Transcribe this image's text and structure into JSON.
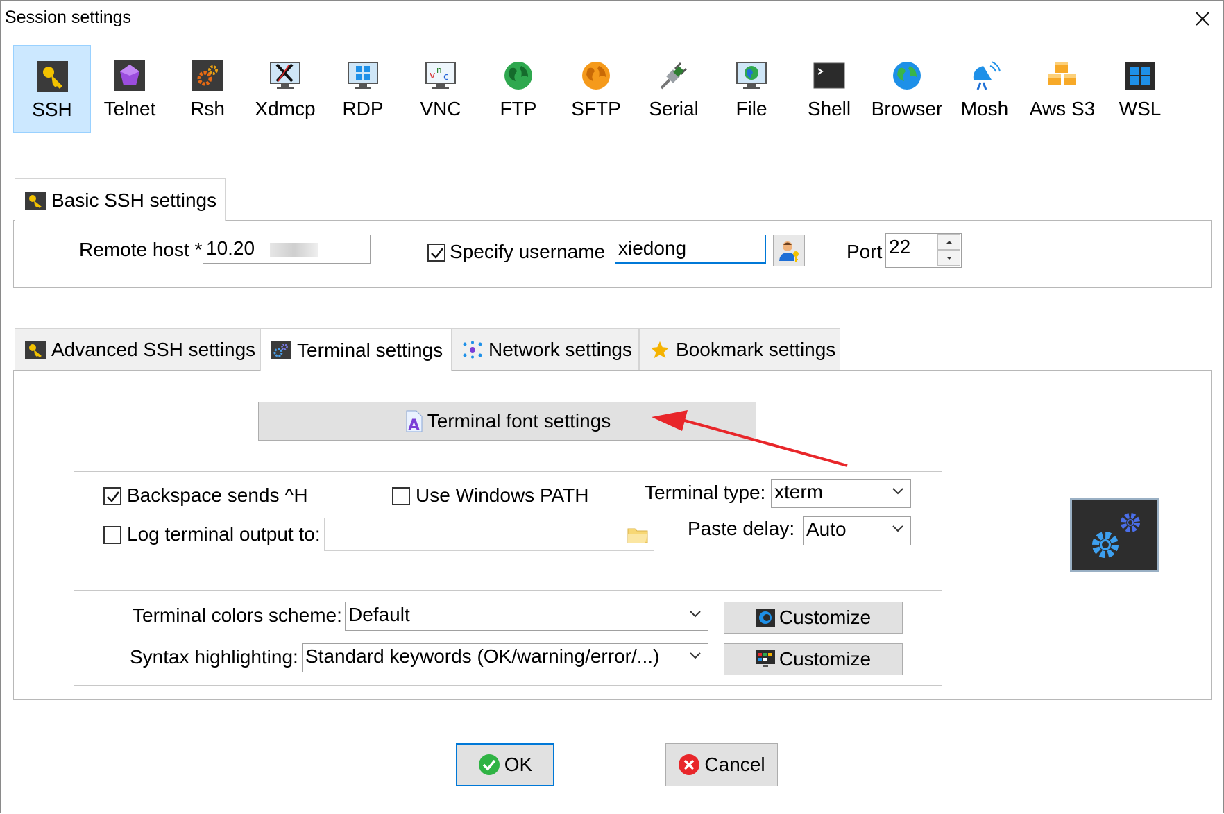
{
  "window": {
    "title": "Session settings"
  },
  "protocols": [
    {
      "label": "SSH",
      "icon": "key-icon",
      "selected": true
    },
    {
      "label": "Telnet",
      "icon": "gem-icon"
    },
    {
      "label": "Rsh",
      "icon": "gears-icon"
    },
    {
      "label": "Xdmcp",
      "icon": "x-monitor-icon"
    },
    {
      "label": "RDP",
      "icon": "windows-monitor-icon"
    },
    {
      "label": "VNC",
      "icon": "vnc-monitor-icon"
    },
    {
      "label": "FTP",
      "icon": "green-globe-icon"
    },
    {
      "label": "SFTP",
      "icon": "orange-globe-icon"
    },
    {
      "label": "Serial",
      "icon": "plug-icon"
    },
    {
      "label": "File",
      "icon": "file-monitor-icon"
    },
    {
      "label": "Shell",
      "icon": "terminal-icon"
    },
    {
      "label": "Browser",
      "icon": "globe-icon"
    },
    {
      "label": "Mosh",
      "icon": "satellite-dish-icon"
    },
    {
      "label": "Aws S3",
      "icon": "cubes-icon"
    },
    {
      "label": "WSL",
      "icon": "windows-logo-icon"
    }
  ],
  "basic": {
    "tab_label": "Basic SSH settings",
    "remote_host_label": "Remote host *",
    "remote_host_value": "10.20",
    "specify_username_label": "Specify username",
    "specify_username_checked": true,
    "username_value": "xiedong",
    "port_label": "Port",
    "port_value": "22"
  },
  "tabs": [
    {
      "label": "Advanced SSH settings",
      "icon": "key-icon"
    },
    {
      "label": "Terminal settings",
      "icon": "gears-icon",
      "active": true
    },
    {
      "label": "Network settings",
      "icon": "network-icon"
    },
    {
      "label": "Bookmark settings",
      "icon": "star-icon"
    }
  ],
  "terminal": {
    "font_button_label": "Terminal font settings",
    "backspace_label": "Backspace sends ^H",
    "backspace_checked": true,
    "use_windows_path_label": "Use Windows PATH",
    "use_windows_path_checked": false,
    "terminal_type_label": "Terminal type:",
    "terminal_type_value": "xterm",
    "log_output_label": "Log terminal output to:",
    "log_output_checked": false,
    "log_output_value": "",
    "paste_delay_label": "Paste delay:",
    "paste_delay_value": "Auto",
    "colors_scheme_label": "Terminal colors scheme:",
    "colors_scheme_value": "Default",
    "customize_label": "Customize",
    "syntax_label": "Syntax highlighting:",
    "syntax_value": "Standard keywords (OK/warning/error/...)",
    "customize2_label": "Customize"
  },
  "footer": {
    "ok_label": "OK",
    "cancel_label": "Cancel"
  },
  "colors": {
    "selected_bg": "#cce8ff",
    "focus_blue": "#0078d7",
    "arrow_red": "#e8262a"
  }
}
